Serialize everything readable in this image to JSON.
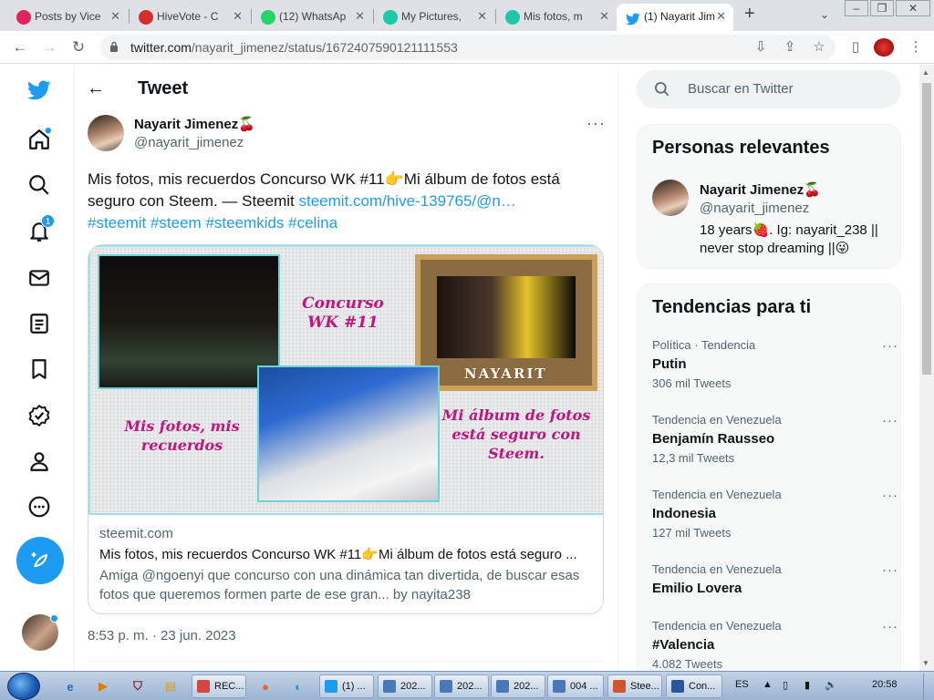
{
  "browser": {
    "tabs": [
      {
        "label": "Posts by Vice",
        "icon": "vice-icon",
        "color": "#e0245e"
      },
      {
        "label": "HiveVote - C",
        "icon": "hivevote-icon",
        "color": "#d32f2f"
      },
      {
        "label": "(12) WhatsAp",
        "icon": "whatsapp-icon",
        "color": "#25d366"
      },
      {
        "label": "My Pictures,",
        "icon": "peakd-icon",
        "color": "#1ec7a6"
      },
      {
        "label": "Mis fotos, m",
        "icon": "peakd-icon",
        "color": "#1ec7a6"
      },
      {
        "label": "(1) Nayarit Jim",
        "icon": "twitter-icon",
        "color": "#1d9bf0"
      }
    ],
    "url_domain": "twitter.com",
    "url_path": "/nayarit_jimenez/status/1672407590121111553"
  },
  "leftnav": {
    "notification_count": "1"
  },
  "header": {
    "title": "Tweet"
  },
  "tweet": {
    "author_name": "Nayarit Jimenez🍒",
    "author_handle": "@nayarit_jimenez",
    "text_plain": "Mis fotos, mis recuerdos Concurso WK #11👉Mi álbum de fotos está seguro con Steem. — Steemit ",
    "text_link": "steemit.com/hive-139765/@n…",
    "hashtags": "#steemit #steem #steemkids #celina",
    "timestamp": "8:53 p. m. · 23 jun. 2023",
    "card": {
      "collage_text_1": "Concurso WK #11",
      "collage_text_2": "Mis fotos, mis recuerdos",
      "collage_text_3": "Mi álbum de fotos está seguro con Steem.",
      "collage_frame_text": "NAYARIT",
      "domain": "steemit.com",
      "title": "Mis fotos, mis recuerdos Concurso WK #11👉Mi álbum de fotos está seguro ...",
      "description": "Amiga @ngoenyi que concurso con una dinámica tan divertida, de buscar esas fotos que queremos formen parte de ese gran... by nayita238"
    }
  },
  "sidebar": {
    "search_placeholder": "Buscar en Twitter",
    "relevant_title": "Personas relevantes",
    "person": {
      "name": "Nayarit Jimenez🍒",
      "handle": "@nayarit_jimenez",
      "bio": "18 years🍓. Ig: nayarit_238 || never stop dreaming ||😜"
    },
    "trends_title": "Tendencias para ti",
    "trends": [
      {
        "category": "Política · Tendencia",
        "name": "Putin",
        "count": "306 mil Tweets"
      },
      {
        "category": "Tendencia en Venezuela",
        "name": "Benjamín Rausseo",
        "count": "12,3 mil Tweets"
      },
      {
        "category": "Tendencia en Venezuela",
        "name": "Indonesia",
        "count": "127 mil Tweets"
      },
      {
        "category": "Tendencia en Venezuela",
        "name": "Emilio Lovera",
        "count": ""
      },
      {
        "category": "Tendencia en Venezuela",
        "name": "#Valencia",
        "count": "4.082 Tweets"
      }
    ]
  },
  "taskbar": {
    "windows": [
      {
        "label": "REC...",
        "color": "#d64541"
      },
      {
        "label": "(1) ...",
        "color": "#1d9bf0"
      },
      {
        "label": "202...",
        "color": "#4a78b8"
      },
      {
        "label": "202...",
        "color": "#4a78b8"
      },
      {
        "label": "202...",
        "color": "#4a78b8"
      },
      {
        "label": "004 ...",
        "color": "#4a78b8"
      },
      {
        "label": "Stee...",
        "color": "#d35230"
      },
      {
        "label": "Con...",
        "color": "#2b579a"
      }
    ],
    "language": "ES",
    "clock": "20:58"
  }
}
